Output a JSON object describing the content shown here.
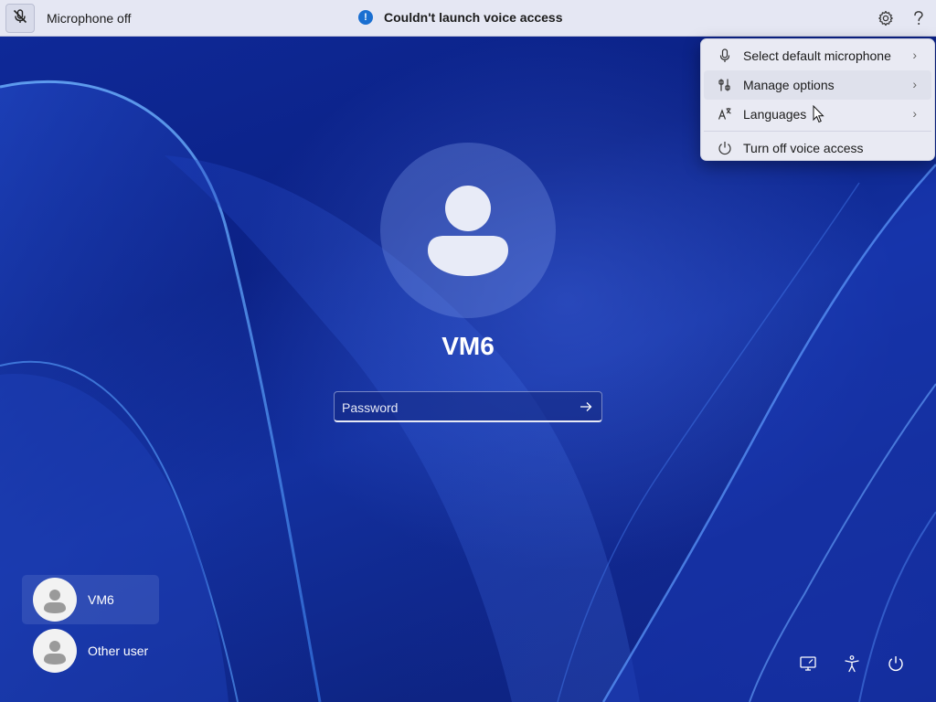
{
  "voice_bar": {
    "mic_status": "Microphone off",
    "alert_text": "Couldn't launch voice access",
    "alert_glyph": "!",
    "icons": {
      "mic": "mic-off-icon",
      "alert": "info-icon",
      "settings": "gear-icon",
      "help": "help-icon"
    }
  },
  "menu": {
    "items": [
      {
        "label": "Select default microphone",
        "icon": "microphone-icon",
        "has_submenu": true
      },
      {
        "label": "Manage options",
        "icon": "options-icon",
        "has_submenu": true
      },
      {
        "label": "Languages",
        "icon": "language-icon",
        "has_submenu": true
      },
      {
        "label": "Turn off voice access",
        "icon": "power-icon",
        "has_submenu": false
      }
    ],
    "hovered": "Manage options"
  },
  "login": {
    "username": "VM6",
    "password_placeholder": "Password",
    "submit_icon": "arrow-right-icon"
  },
  "user_list": [
    {
      "name": "VM6",
      "selected": true
    },
    {
      "name": "Other user",
      "selected": false
    }
  ],
  "bottom_icons": [
    "network-icon",
    "accessibility-icon",
    "power-icon"
  ],
  "colors": {
    "wallpaper_base": "#0b2185",
    "bar_bg": "#e5e7f3",
    "menu_bg": "#e9eaf3",
    "alert_blue": "#1a6fd1"
  }
}
